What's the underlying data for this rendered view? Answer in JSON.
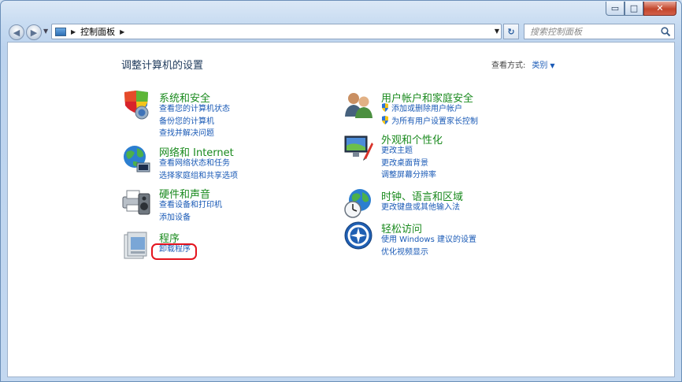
{
  "window": {
    "controls": {
      "minimize": "▭",
      "maximize": "□",
      "close": "✕"
    }
  },
  "address": {
    "breadcrumb": "控制面板",
    "search_placeholder": "搜索控制面板"
  },
  "header": {
    "title": "调整计算机的设置",
    "view_by_label": "查看方式:",
    "view_by_value": "类别"
  },
  "categories": [
    {
      "heading": "系统和安全",
      "icon": "shield-computer-icon",
      "links": [
        "查看您的计算机状态",
        "备份您的计算机",
        "查找并解决问题"
      ]
    },
    {
      "heading": "网络和 Internet",
      "icon": "network-globe-icon",
      "links": [
        "查看网络状态和任务",
        "选择家庭组和共享选项"
      ]
    },
    {
      "heading": "硬件和声音",
      "icon": "printer-speaker-icon",
      "links": [
        "查看设备和打印机",
        "添加设备"
      ]
    },
    {
      "heading": "程序",
      "icon": "programs-icon",
      "links": [
        "卸载程序"
      ]
    },
    {
      "heading": "用户帐户和家庭安全",
      "icon": "users-icon",
      "links": [
        "添加或删除用户帐户",
        "为所有用户设置家长控制"
      ]
    },
    {
      "heading": "外观和个性化",
      "icon": "monitor-paint-icon",
      "links": [
        "更改主题",
        "更改桌面背景",
        "调整屏幕分辨率"
      ]
    },
    {
      "heading": "时钟、语言和区域",
      "icon": "globe-clock-icon",
      "links": [
        "更改键盘或其他输入法"
      ]
    },
    {
      "heading": "轻松访问",
      "icon": "accessibility-icon",
      "links": [
        "使用 Windows 建议的设置",
        "优化视频显示"
      ]
    }
  ],
  "colors": {
    "heading_green": "#1a8a1e",
    "link_blue": "#1a5ab6",
    "highlight_red": "#e4141e"
  }
}
